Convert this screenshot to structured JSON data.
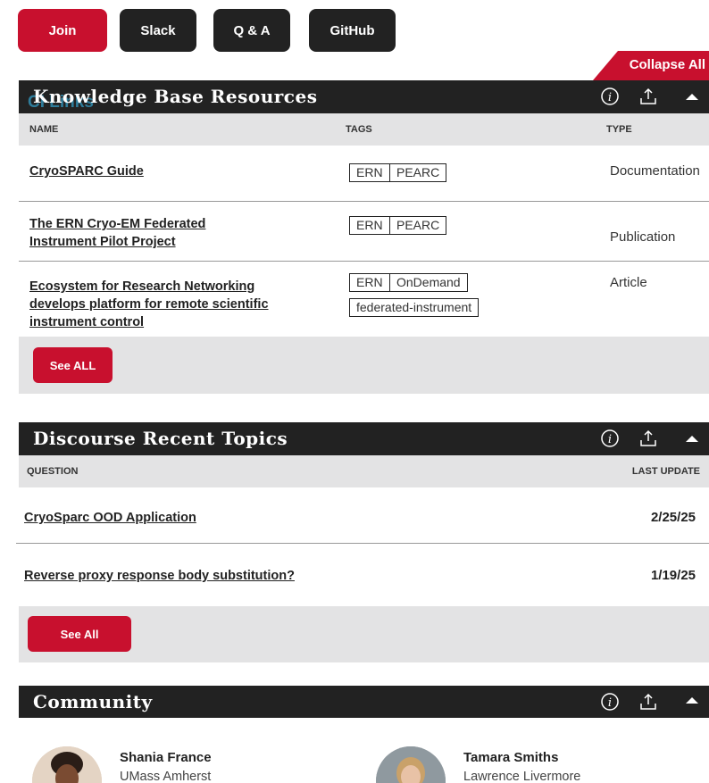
{
  "top_buttons": [
    {
      "label": "Join"
    },
    {
      "label": "Slack"
    },
    {
      "label": "Q & A"
    },
    {
      "label": "GitHub"
    }
  ],
  "collapse_all_label": "Collapse All",
  "knowledge_base": {
    "title": "Knowledge Base Resources",
    "overlap_text": "CI Links",
    "columns": {
      "name": "NAME",
      "tags": "TAGS",
      "type": "TYPE"
    },
    "rows": [
      {
        "name_lines": [
          "CryoSPARC Guide"
        ],
        "tags": [
          "ERN",
          "PEARC"
        ],
        "type": "Documentation"
      },
      {
        "name_lines": [
          "The ERN Cryo-EM Federated",
          "Instrument Pilot Project"
        ],
        "tags": [
          "ERN",
          "PEARC"
        ],
        "type": "Publication"
      },
      {
        "name_lines": [
          "Ecosystem for Research Networking",
          "develops platform for remote scientific",
          "instrument control"
        ],
        "tags": [
          "ERN",
          "OnDemand",
          "federated-instrument"
        ],
        "type": "Article"
      }
    ],
    "see_all_label": "See ALL"
  },
  "discourse": {
    "title": "Discourse Recent Topics",
    "columns": {
      "question": "QUESTION",
      "last_update": "LAST UPDATE"
    },
    "rows": [
      {
        "question": "CryoSparc OOD Application",
        "date": "2/25/25"
      },
      {
        "question": "Reverse proxy response body substitution?",
        "date": "1/19/25"
      }
    ],
    "see_all_label": "See All"
  },
  "community": {
    "title": "Community",
    "people": [
      {
        "name": "Shania France",
        "org": "UMass Amherst"
      },
      {
        "name": "Tamara Smiths",
        "org": "Lawrence Livermore"
      }
    ]
  },
  "colors": {
    "accent": "#c8102e",
    "header": "#222222",
    "panel": "#e3e3e4"
  }
}
